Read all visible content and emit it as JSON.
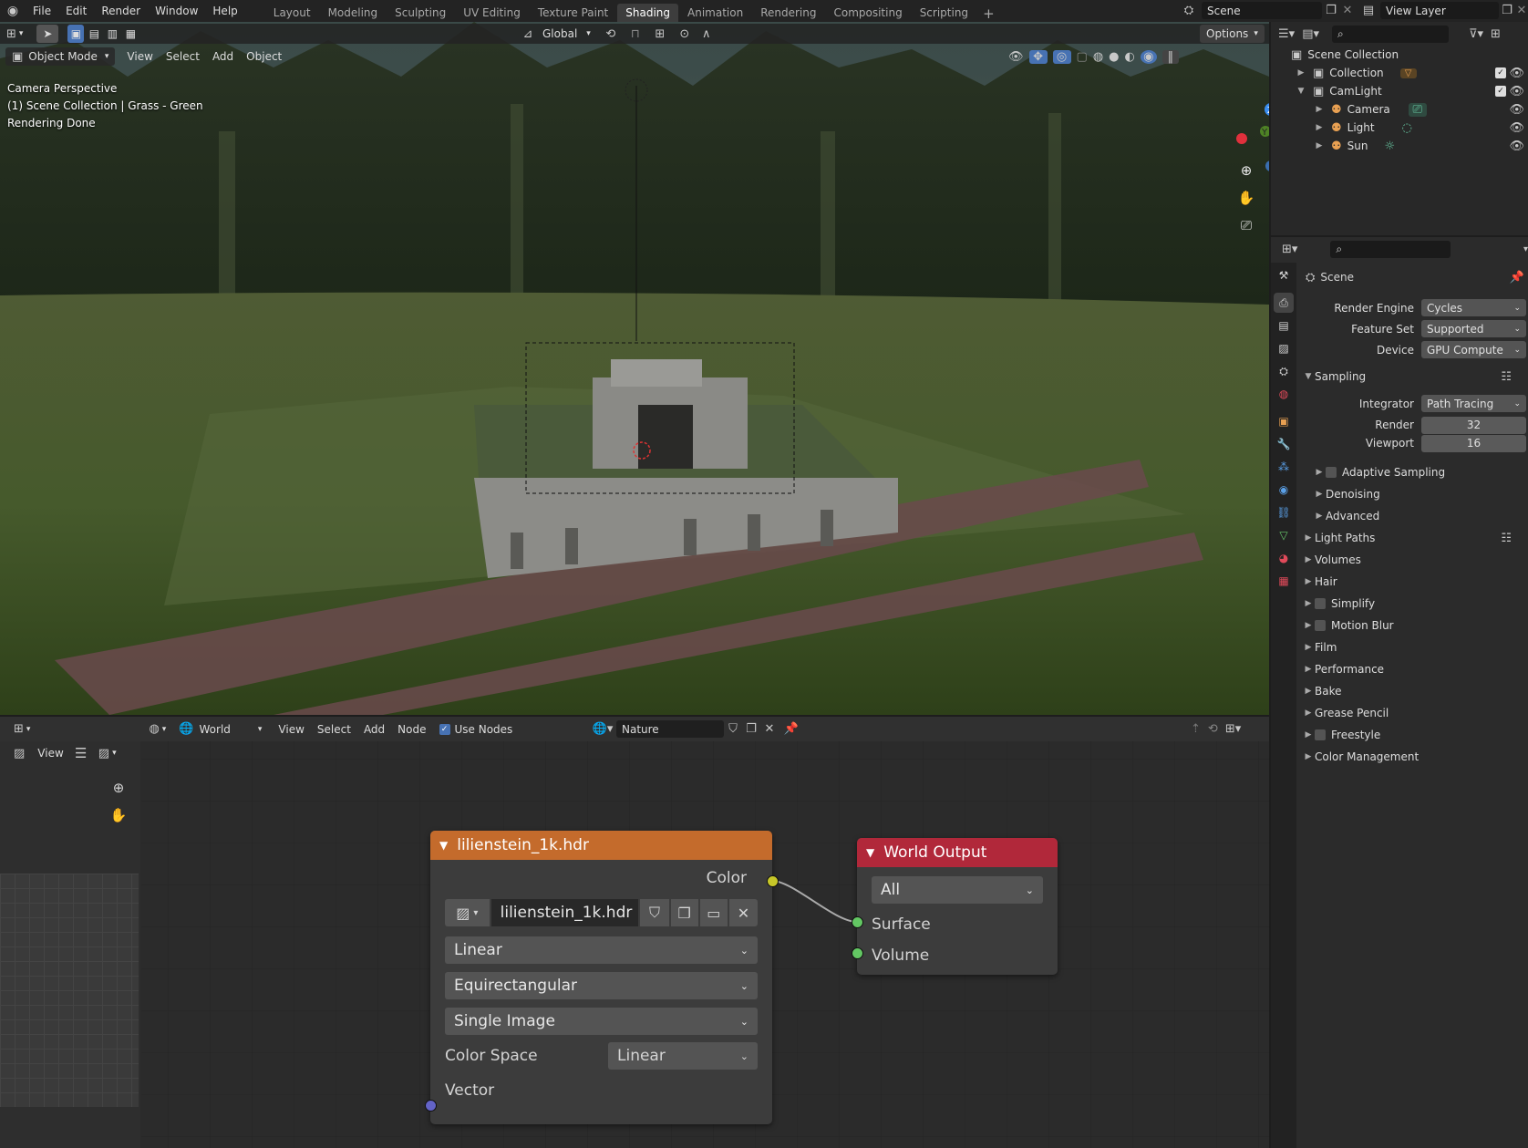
{
  "topbar": {
    "menus": [
      "File",
      "Edit",
      "Render",
      "Window",
      "Help"
    ],
    "workspaces": [
      "Layout",
      "Modeling",
      "Sculpting",
      "UV Editing",
      "Texture Paint",
      "Shading",
      "Animation",
      "Rendering",
      "Compositing",
      "Scripting"
    ],
    "active_workspace": "Shading",
    "add_tab": "+",
    "scene": "Scene",
    "view_layer": "View Layer"
  },
  "viewport": {
    "mode": "Object Mode",
    "menus": [
      "View",
      "Select",
      "Add",
      "Object"
    ],
    "orientation": "Global",
    "options": "Options",
    "overlay_text": [
      "Camera Perspective",
      "(1) Scene Collection | Grass - Green",
      "Rendering Done"
    ],
    "gizmo": {
      "z": "Z",
      "y": "Y"
    }
  },
  "node_editor": {
    "left_view": "View",
    "world_type": "World",
    "menus": [
      "View",
      "Select",
      "Add",
      "Node"
    ],
    "use_nodes": "Use Nodes",
    "world_name": "Nature",
    "env_node": {
      "title": "lilienstein_1k.hdr",
      "output": "Color",
      "image": "lilienstein_1k.hdr",
      "interpolation": "Linear",
      "projection": "Equirectangular",
      "source": "Single Image",
      "color_space_label": "Color Space",
      "color_space": "Linear",
      "input": "Vector"
    },
    "output_node": {
      "title": "World Output",
      "target": "All",
      "inputs": [
        "Surface",
        "Volume"
      ]
    }
  },
  "outliner": {
    "root": "Scene Collection",
    "items": [
      {
        "label": "Collection",
        "depth": 1
      },
      {
        "label": "CamLight",
        "depth": 1
      },
      {
        "label": "Camera",
        "depth": 2
      },
      {
        "label": "Light",
        "depth": 2
      },
      {
        "label": "Sun",
        "depth": 2
      }
    ]
  },
  "properties": {
    "context": "Scene",
    "render_engine_label": "Render Engine",
    "render_engine": "Cycles",
    "feature_set_label": "Feature Set",
    "feature_set": "Supported",
    "device_label": "Device",
    "device": "GPU Compute",
    "sampling": "Sampling",
    "integrator_label": "Integrator",
    "integrator": "Path Tracing",
    "render_label": "Render",
    "render_samples": "32",
    "viewport_label": "Viewport",
    "viewport_samples": "16",
    "subpanels": [
      "Adaptive Sampling",
      "Denoising",
      "Advanced"
    ],
    "panels": [
      "Light Paths",
      "Volumes",
      "Hair",
      "Simplify",
      "Motion Blur",
      "Film",
      "Performance",
      "Bake",
      "Grease Pencil",
      "Freestyle",
      "Color Management"
    ]
  },
  "colors": {
    "active_tab": "#3d3d3d",
    "env_header": "#c46b2c",
    "output_header": "#b1283a",
    "socket_color": "#c7c729",
    "socket_shader": "#63c763",
    "socket_vector": "#6363c7"
  }
}
